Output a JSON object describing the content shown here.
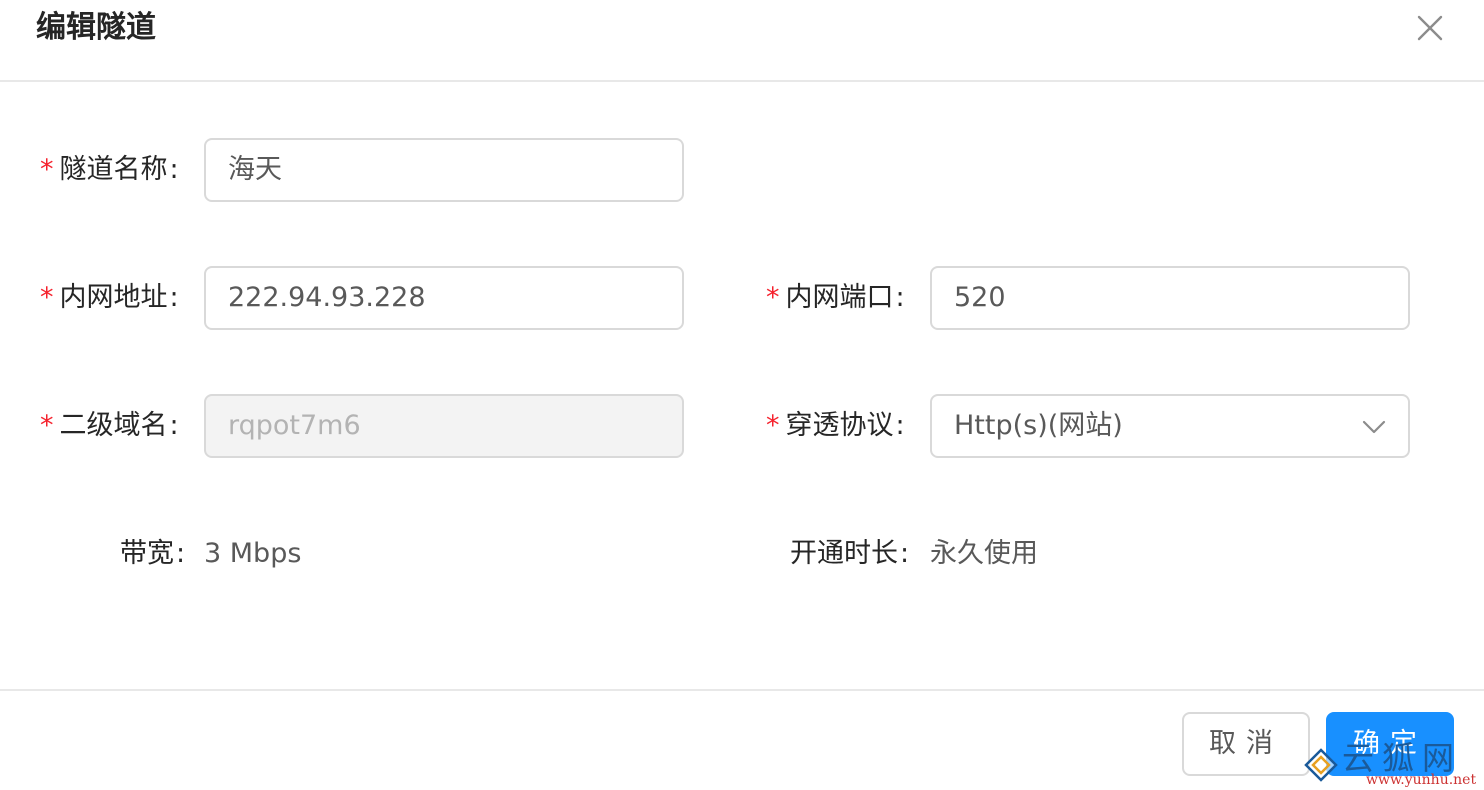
{
  "dialog": {
    "title": "编辑隧道",
    "close_icon": "close-icon"
  },
  "form": {
    "required_mark": "*",
    "colon": ":",
    "tunnel_name": {
      "label": "隧道名称",
      "value": "海天"
    },
    "lan_address": {
      "label": "内网地址",
      "value": "222.94.93.228"
    },
    "lan_port": {
      "label": "内网端口",
      "value": "520"
    },
    "subdomain": {
      "label": "二级域名",
      "value": "rqpot7m6",
      "disabled": true
    },
    "protocol": {
      "label": "穿透协议",
      "value": "Http(s)(网站)",
      "icon": "chevron-down-icon"
    },
    "bandwidth": {
      "label": "带宽",
      "value": "3 Mbps"
    },
    "duration": {
      "label": "开通时长",
      "value": "永久使用"
    }
  },
  "footer": {
    "cancel_label": "取消",
    "ok_label": "确定"
  },
  "watermark": {
    "text_cn": "云狐网",
    "url": "www.yunhu.net"
  },
  "colors": {
    "required": "#f5222d",
    "primary": "#1890ff",
    "border": "#d9d9d9",
    "disabled_bg": "#f3f3f3"
  }
}
